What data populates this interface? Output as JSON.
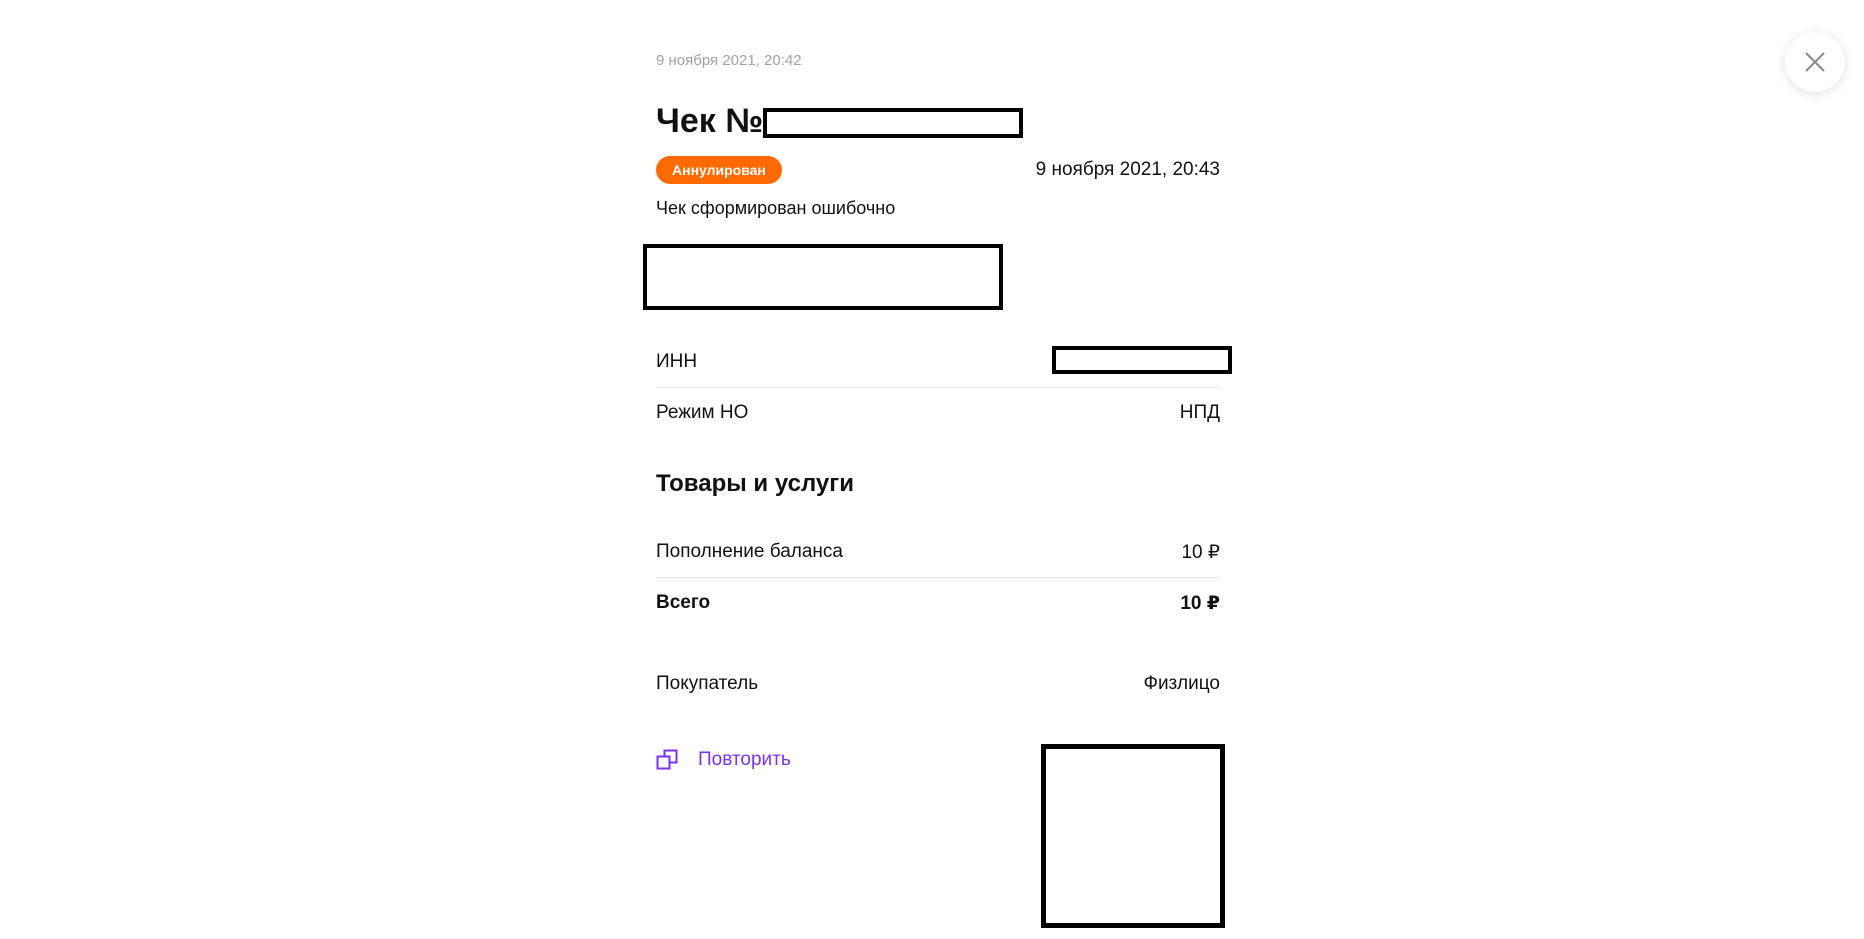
{
  "close": {
    "icon": "close-icon"
  },
  "receipt": {
    "created_at": "9 ноября 2021, 20:42",
    "title": "Чек №",
    "status": "Аннулирован",
    "status_color": "#ff6a00",
    "cancel_date": "9 ноября 2021, 20:43",
    "cancel_reason": "Чек сформирован ошибочно",
    "inn_label": "ИНН",
    "tax_mode_label": "Режим НО",
    "tax_mode_value": "НПД",
    "goods_section_title": "Товары и услуги",
    "items": [
      {
        "name": "Пополнение баланса",
        "amount": "10 ₽"
      }
    ],
    "total_label": "Всего",
    "total_value": "10 ₽",
    "buyer_label": "Покупатель",
    "buyer_value": "Физлицо",
    "repeat_label": "Повторить",
    "repeat_icon": "copy-icon",
    "link_color": "#7b2ff7"
  }
}
